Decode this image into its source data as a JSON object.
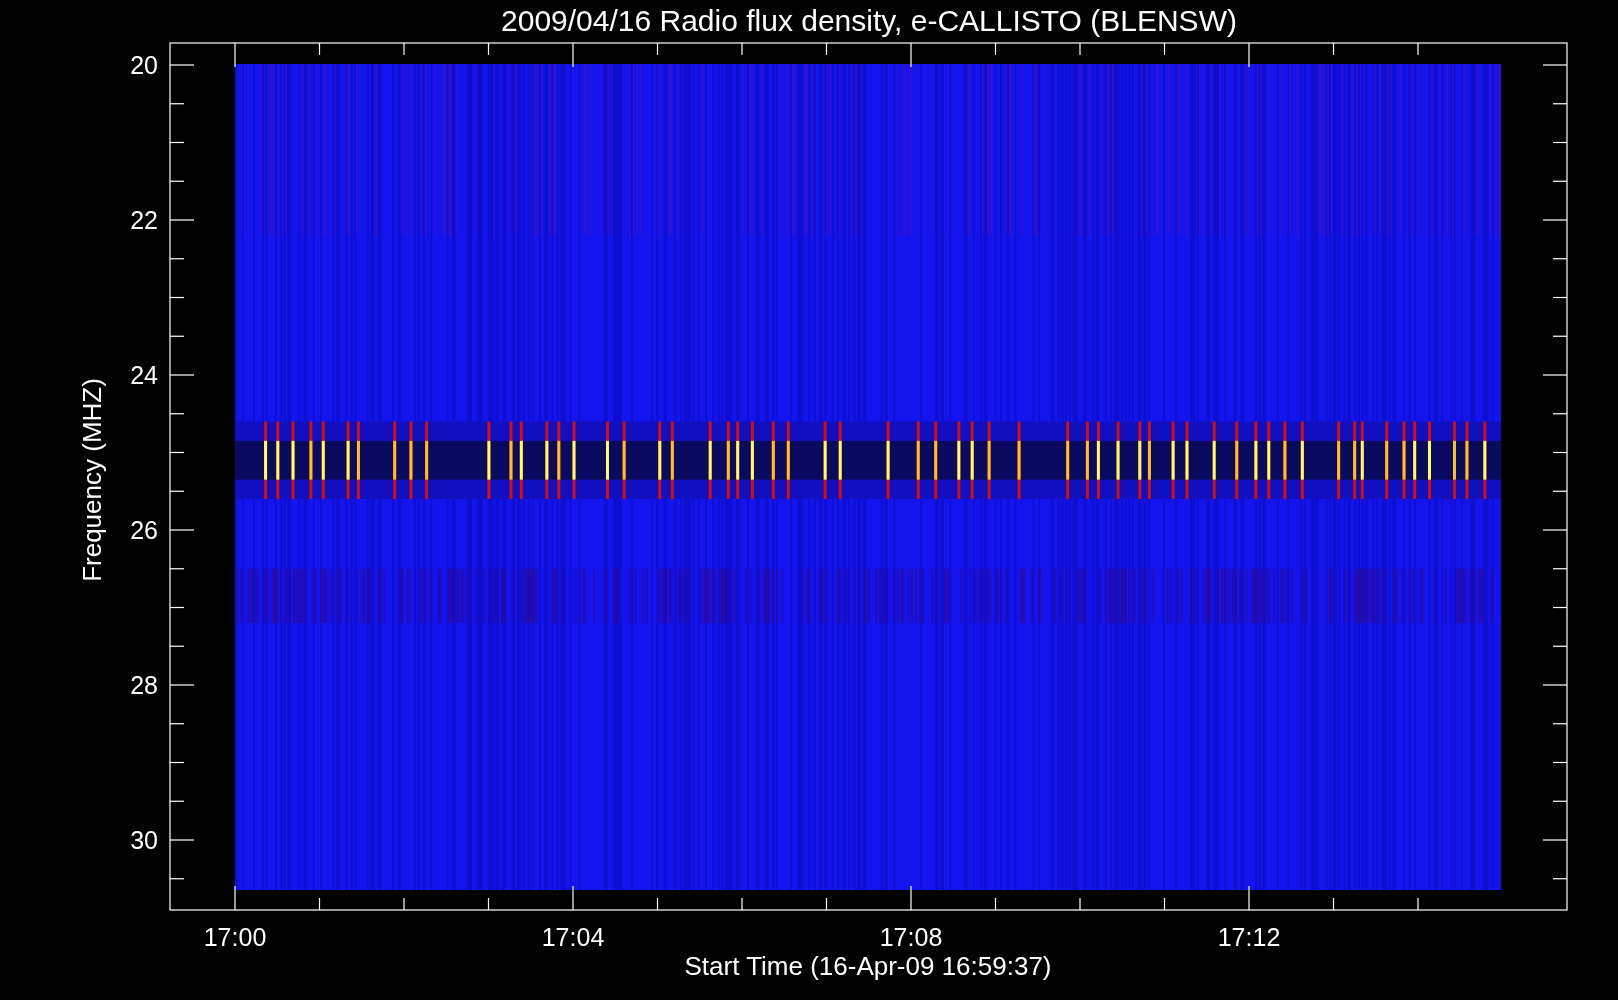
{
  "title": "2009/04/16  Radio flux density, e-CALLISTO (BLENSW)",
  "plot": {
    "ylabel": "Frequency (MHZ)",
    "xlabel": "Start Time (16-Apr-09 16:59:37)",
    "yticks": [
      "20",
      "22",
      "24",
      "26",
      "28",
      "30"
    ],
    "xticks": [
      "17:00",
      "17:04",
      "17:08",
      "17:12"
    ]
  }
}
